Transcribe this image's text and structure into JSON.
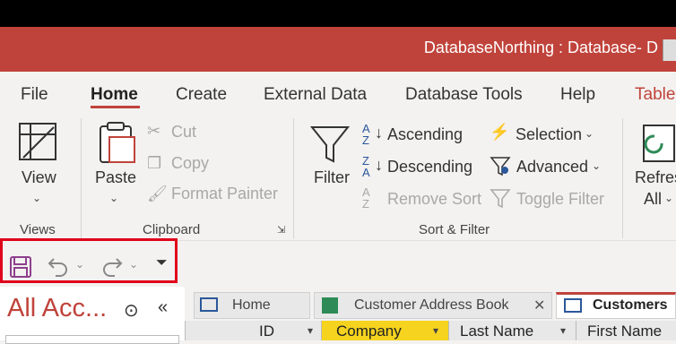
{
  "window": {
    "title": "DatabaseNorthing : Database- D"
  },
  "menu": {
    "tabs": [
      "File",
      "Home",
      "Create",
      "External Data",
      "Database Tools",
      "Help",
      "Table"
    ]
  },
  "ribbon": {
    "views": {
      "view_label": "View",
      "group": "Views"
    },
    "clipboard": {
      "paste": "Paste",
      "cut": "Cut",
      "copy": "Copy",
      "format_painter": "Format Painter",
      "group": "Clipboard"
    },
    "sort_filter": {
      "filter": "Filter",
      "ascending": "Ascending",
      "descending": "Descending",
      "remove_sort": "Remove Sort",
      "selection": "Selection",
      "advanced": "Advanced",
      "toggle_filter": "Toggle Filter",
      "group": "Sort & Filter"
    },
    "records": {
      "refresh": "Refres",
      "refresh_all": "All"
    }
  },
  "nav_pane": {
    "title": "All Acc..."
  },
  "doc_tabs": [
    "Home",
    "Customer Address Book",
    "Customers"
  ],
  "grid": {
    "columns": [
      "ID",
      "Company",
      "Last Name",
      "First Name"
    ]
  },
  "colors": {
    "accent": "#c0433b",
    "highlight": "#e0001b",
    "column_highlight": "#f5d31e"
  }
}
